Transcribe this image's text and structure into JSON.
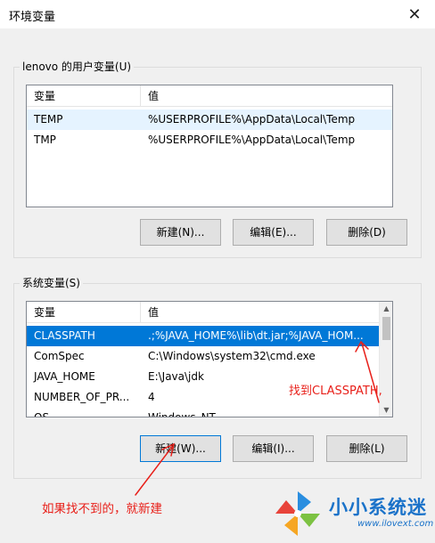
{
  "window": {
    "title": "环境变量",
    "close_glyph": "✕"
  },
  "user_vars": {
    "group_label": "lenovo 的用户变量(U)",
    "columns": [
      "变量",
      "值"
    ],
    "rows": [
      {
        "name": "TEMP",
        "value": "%USERPROFILE%\\AppData\\Local\\Temp"
      },
      {
        "name": "TMP",
        "value": "%USERPROFILE%\\AppData\\Local\\Temp"
      }
    ],
    "buttons": {
      "new": "新建(N)...",
      "edit": "编辑(E)...",
      "delete": "删除(D)"
    }
  },
  "system_vars": {
    "group_label": "系统变量(S)",
    "columns": [
      "变量",
      "值"
    ],
    "rows": [
      {
        "name": "CLASSPATH",
        "value": ".;%JAVA_HOME%\\lib\\dt.jar;%JAVA_HOM..."
      },
      {
        "name": "ComSpec",
        "value": "C:\\Windows\\system32\\cmd.exe"
      },
      {
        "name": "JAVA_HOME",
        "value": "E:\\Java\\jdk"
      },
      {
        "name": "NUMBER_OF_PR...",
        "value": "4"
      },
      {
        "name": "OS",
        "value": "Windows_NT"
      }
    ],
    "selected_row": "CLASSPATH",
    "buttons": {
      "new": "新建(W)...",
      "edit": "编辑(I)...",
      "delete": "删除(L)"
    }
  },
  "annotations": {
    "find_classpath": "找到CLASSPATH,",
    "create_if_missing": "如果找不到的，就新建"
  },
  "watermark": {
    "title": "小小系统迷",
    "url": "www.ilovext.com"
  },
  "colors": {
    "selection": "#0078d7",
    "annotation_red": "#e8201a",
    "watermark_blue": "#1a72c9"
  },
  "icons": {
    "close": "close-icon",
    "scroll_up": "chevron-up-icon",
    "scroll_down": "chevron-down-icon",
    "watermark_logo": "pinwheel-logo-icon"
  }
}
